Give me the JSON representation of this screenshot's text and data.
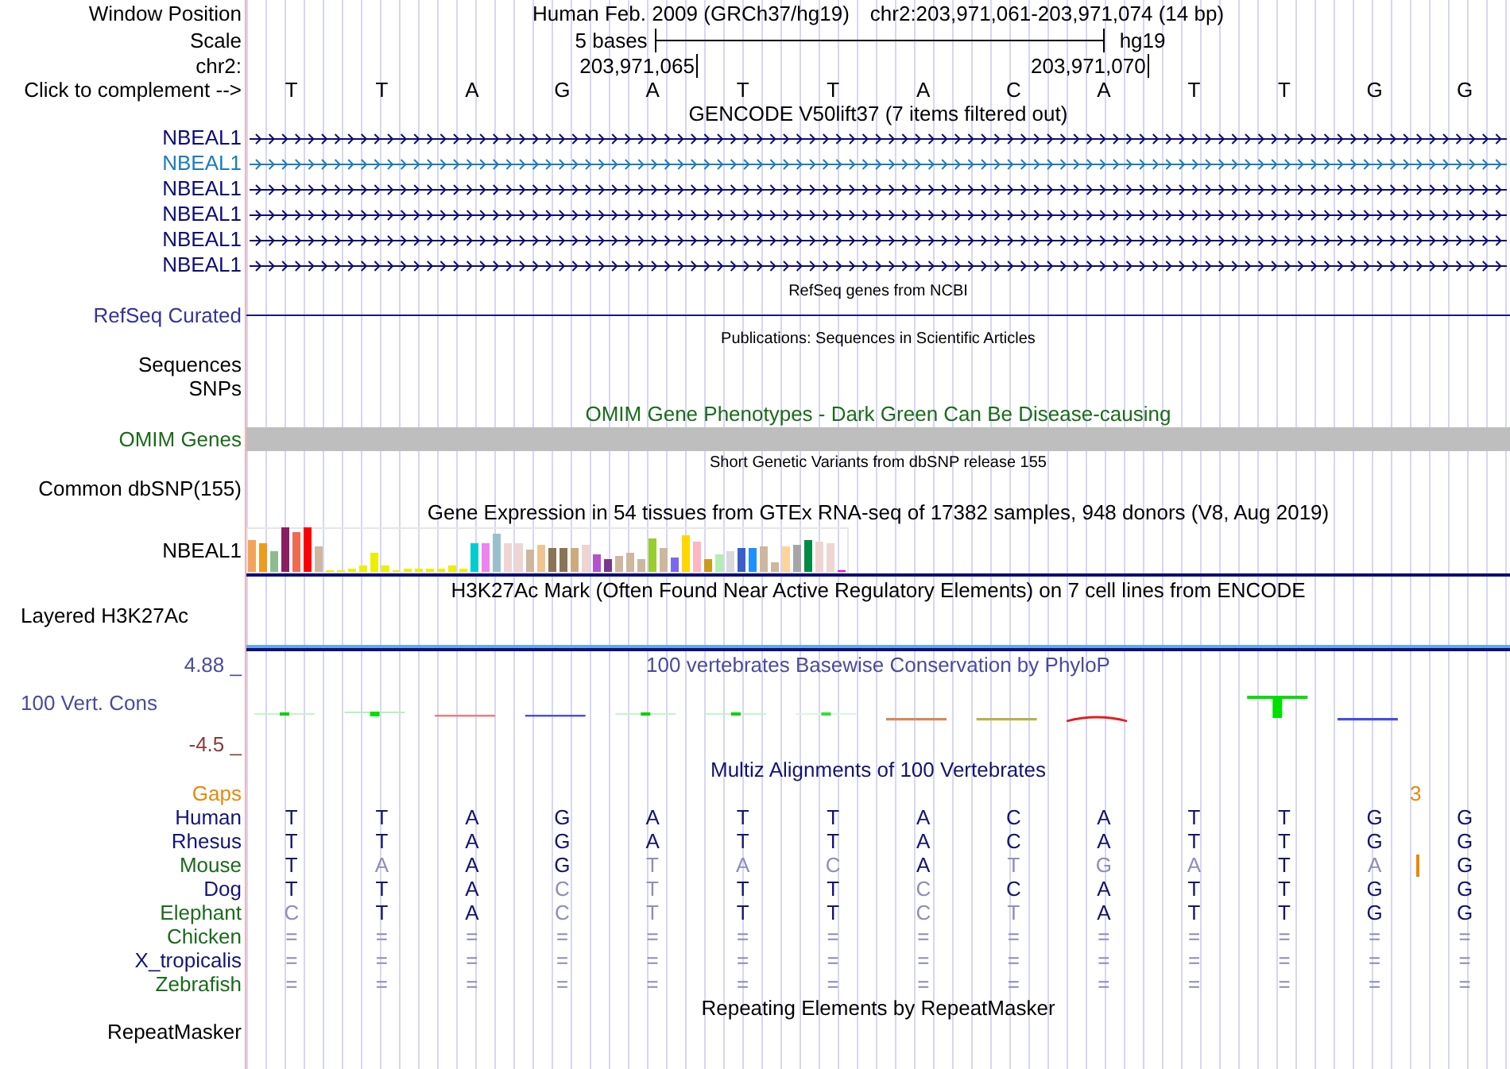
{
  "header": {
    "label": "Window Position",
    "assembly": "Human Feb. 2009 (GRCh37/hg19)",
    "position": "chr2:203,971,061-203,971,074 (14 bp)"
  },
  "scale": {
    "label": "Scale",
    "span": "5 bases",
    "assembly": "hg19"
  },
  "chromosome": {
    "label": "chr2:",
    "ticks": [
      "203,971,065",
      "203,971,070"
    ]
  },
  "sequence": {
    "label": "Click to complement -->",
    "bases": [
      "T",
      "T",
      "A",
      "G",
      "A",
      "T",
      "T",
      "A",
      "C",
      "A",
      "T",
      "T",
      "G",
      "G"
    ]
  },
  "gencode": {
    "title": "GENCODE V50lift37 (7 items filtered out)",
    "items": [
      {
        "label": "NBEAL1",
        "color": "#0c0c78"
      },
      {
        "label": "NBEAL1",
        "color": "#1a7cbc"
      },
      {
        "label": "NBEAL1",
        "color": "#0c0c78"
      },
      {
        "label": "NBEAL1",
        "color": "#0c0c78"
      },
      {
        "label": "NBEAL1",
        "color": "#0c0c78"
      },
      {
        "label": "NBEAL1",
        "color": "#0c0c78"
      }
    ]
  },
  "refseq": {
    "title": "RefSeq genes from NCBI",
    "label": "RefSeq Curated"
  },
  "publications": {
    "title": "Publications: Sequences in Scientific Articles",
    "labels": [
      "Sequences",
      "SNPs"
    ]
  },
  "omim": {
    "title": "OMIM Gene Phenotypes - Dark Green Can Be Disease-causing",
    "label": "OMIM Genes"
  },
  "dbsnp": {
    "title": "Short Genetic Variants from dbSNP release 155",
    "label": "Common dbSNP(155)"
  },
  "gtex": {
    "title": "Gene Expression in 54 tissues from GTEx RNA-seq of 17382 samples, 948 donors (V8, Aug 2019)",
    "label": "NBEAL1"
  },
  "h3k27ac": {
    "title": "H3K27Ac Mark (Often Found Near Active Regulatory Elements) on 7 cell lines from ENCODE",
    "label": "Layered H3K27Ac"
  },
  "phylop": {
    "title": "100 vertebrates Basewise Conservation by PhyloP",
    "max_label": "4.88 _",
    "label": "100 Vert. Cons",
    "min_label": "-4.5 _"
  },
  "multiz": {
    "title": "Multiz Alignments of 100 Vertebrates",
    "gaps": {
      "label": "Gaps",
      "count": "3"
    },
    "species": [
      {
        "name": "Human",
        "color": "#14147a",
        "insertion": false,
        "bases": [
          {
            "base": "T",
            "match": true
          },
          {
            "base": "T",
            "match": true
          },
          {
            "base": "A",
            "match": true
          },
          {
            "base": "G",
            "match": true
          },
          {
            "base": "A",
            "match": true
          },
          {
            "base": "T",
            "match": true
          },
          {
            "base": "T",
            "match": true
          },
          {
            "base": "A",
            "match": true
          },
          {
            "base": "C",
            "match": true
          },
          {
            "base": "A",
            "match": true
          },
          {
            "base": "T",
            "match": true
          },
          {
            "base": "T",
            "match": true
          },
          {
            "base": "G",
            "match": true
          },
          {
            "base": "G",
            "match": true
          }
        ]
      },
      {
        "name": "Rhesus",
        "color": "#14147a",
        "insertion": false,
        "bases": [
          {
            "base": "T",
            "match": true
          },
          {
            "base": "T",
            "match": true
          },
          {
            "base": "A",
            "match": true
          },
          {
            "base": "G",
            "match": true
          },
          {
            "base": "A",
            "match": true
          },
          {
            "base": "T",
            "match": true
          },
          {
            "base": "T",
            "match": true
          },
          {
            "base": "A",
            "match": true
          },
          {
            "base": "C",
            "match": true
          },
          {
            "base": "A",
            "match": true
          },
          {
            "base": "T",
            "match": true
          },
          {
            "base": "T",
            "match": true
          },
          {
            "base": "G",
            "match": true
          },
          {
            "base": "G",
            "match": true
          }
        ]
      },
      {
        "name": "Mouse",
        "color": "#1a6b1a",
        "insertion": true,
        "bases": [
          {
            "base": "T",
            "match": true
          },
          {
            "base": "A",
            "match": false
          },
          {
            "base": "A",
            "match": true
          },
          {
            "base": "G",
            "match": true
          },
          {
            "base": "T",
            "match": false
          },
          {
            "base": "A",
            "match": false
          },
          {
            "base": "C",
            "match": false
          },
          {
            "base": "A",
            "match": true
          },
          {
            "base": "T",
            "match": false
          },
          {
            "base": "G",
            "match": false
          },
          {
            "base": "A",
            "match": false
          },
          {
            "base": "T",
            "match": true
          },
          {
            "base": "A",
            "match": false
          },
          {
            "base": "G",
            "match": true
          }
        ]
      },
      {
        "name": "Dog",
        "color": "#14147a",
        "insertion": false,
        "bases": [
          {
            "base": "T",
            "match": true
          },
          {
            "base": "T",
            "match": true
          },
          {
            "base": "A",
            "match": true
          },
          {
            "base": "C",
            "match": false
          },
          {
            "base": "T",
            "match": false
          },
          {
            "base": "T",
            "match": true
          },
          {
            "base": "T",
            "match": true
          },
          {
            "base": "C",
            "match": false
          },
          {
            "base": "C",
            "match": true
          },
          {
            "base": "A",
            "match": true
          },
          {
            "base": "T",
            "match": true
          },
          {
            "base": "T",
            "match": true
          },
          {
            "base": "G",
            "match": true
          },
          {
            "base": "G",
            "match": true
          }
        ]
      },
      {
        "name": "Elephant",
        "color": "#1a6b1a",
        "insertion": false,
        "bases": [
          {
            "base": "C",
            "match": false
          },
          {
            "base": "T",
            "match": true
          },
          {
            "base": "A",
            "match": true
          },
          {
            "base": "C",
            "match": false
          },
          {
            "base": "T",
            "match": false
          },
          {
            "base": "T",
            "match": true
          },
          {
            "base": "T",
            "match": true
          },
          {
            "base": "C",
            "match": false
          },
          {
            "base": "T",
            "match": false
          },
          {
            "base": "A",
            "match": true
          },
          {
            "base": "T",
            "match": true
          },
          {
            "base": "T",
            "match": true
          },
          {
            "base": "G",
            "match": true
          },
          {
            "base": "G",
            "match": true
          }
        ]
      },
      {
        "name": "Chicken",
        "color": "#1a6b1a",
        "insertion": false,
        "bases": [
          {
            "base": "=",
            "match": false
          },
          {
            "base": "=",
            "match": false
          },
          {
            "base": "=",
            "match": false
          },
          {
            "base": "=",
            "match": false
          },
          {
            "base": "=",
            "match": false
          },
          {
            "base": "=",
            "match": false
          },
          {
            "base": "=",
            "match": false
          },
          {
            "base": "=",
            "match": false
          },
          {
            "base": "=",
            "match": false
          },
          {
            "base": "=",
            "match": false
          },
          {
            "base": "=",
            "match": false
          },
          {
            "base": "=",
            "match": false
          },
          {
            "base": "=",
            "match": false
          },
          {
            "base": "=",
            "match": false
          }
        ]
      },
      {
        "name": "X_tropicalis",
        "color": "#14147a",
        "insertion": false,
        "bases": [
          {
            "base": "=",
            "match": false
          },
          {
            "base": "=",
            "match": false
          },
          {
            "base": "=",
            "match": false
          },
          {
            "base": "=",
            "match": false
          },
          {
            "base": "=",
            "match": false
          },
          {
            "base": "=",
            "match": false
          },
          {
            "base": "=",
            "match": false
          },
          {
            "base": "=",
            "match": false
          },
          {
            "base": "=",
            "match": false
          },
          {
            "base": "=",
            "match": false
          },
          {
            "base": "=",
            "match": false
          },
          {
            "base": "=",
            "match": false
          },
          {
            "base": "=",
            "match": false
          },
          {
            "base": "=",
            "match": false
          }
        ]
      },
      {
        "name": "Zebrafish",
        "color": "#1a6b1a",
        "insertion": false,
        "bases": [
          {
            "base": "=",
            "match": false
          },
          {
            "base": "=",
            "match": false
          },
          {
            "base": "=",
            "match": false
          },
          {
            "base": "=",
            "match": false
          },
          {
            "base": "=",
            "match": false
          },
          {
            "base": "=",
            "match": false
          },
          {
            "base": "=",
            "match": false
          },
          {
            "base": "=",
            "match": false
          },
          {
            "base": "=",
            "match": false
          },
          {
            "base": "=",
            "match": false
          },
          {
            "base": "=",
            "match": false
          },
          {
            "base": "=",
            "match": false
          },
          {
            "base": "=",
            "match": false
          },
          {
            "base": "=",
            "match": false
          }
        ]
      }
    ]
  },
  "repeatmasker": {
    "title": "Repeating Elements by RepeatMasker",
    "label": "RepeatMasker"
  }
}
